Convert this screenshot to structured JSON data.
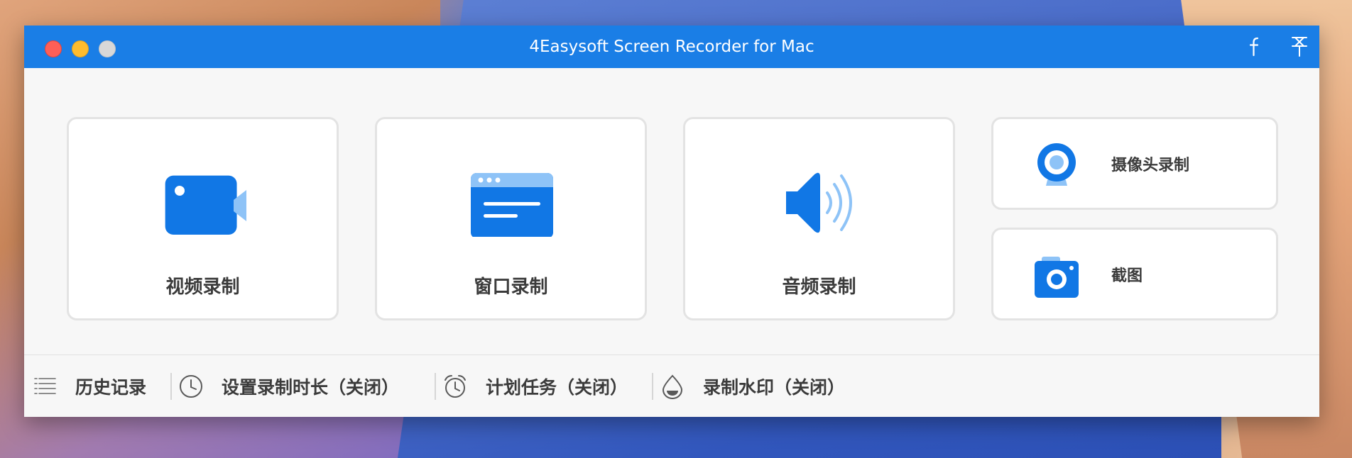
{
  "window": {
    "title": "4Easysoft Screen Recorder for Mac"
  },
  "titlebar_icons": [
    "facebook-icon",
    "pin-icon"
  ],
  "cards": {
    "video": {
      "label": "视频录制",
      "icon": "video-camera-icon"
    },
    "window": {
      "label": "窗口录制",
      "icon": "window-icon"
    },
    "audio": {
      "label": "音频录制",
      "icon": "speaker-icon"
    },
    "webcam": {
      "label": "摄像头录制",
      "icon": "webcam-icon"
    },
    "snapshot": {
      "label": "截图",
      "icon": "camera-icon"
    }
  },
  "footer": {
    "history": "历史记录",
    "set_duration": "设置录制时长（关闭）",
    "schedule": "计划任务（关闭）",
    "watermark": "录制水印（关闭）"
  },
  "colors": {
    "accent": "#1a7ee6",
    "icon_primary": "#1177e5",
    "icon_light": "#8ec3f7",
    "text": "#3b3b3b"
  }
}
